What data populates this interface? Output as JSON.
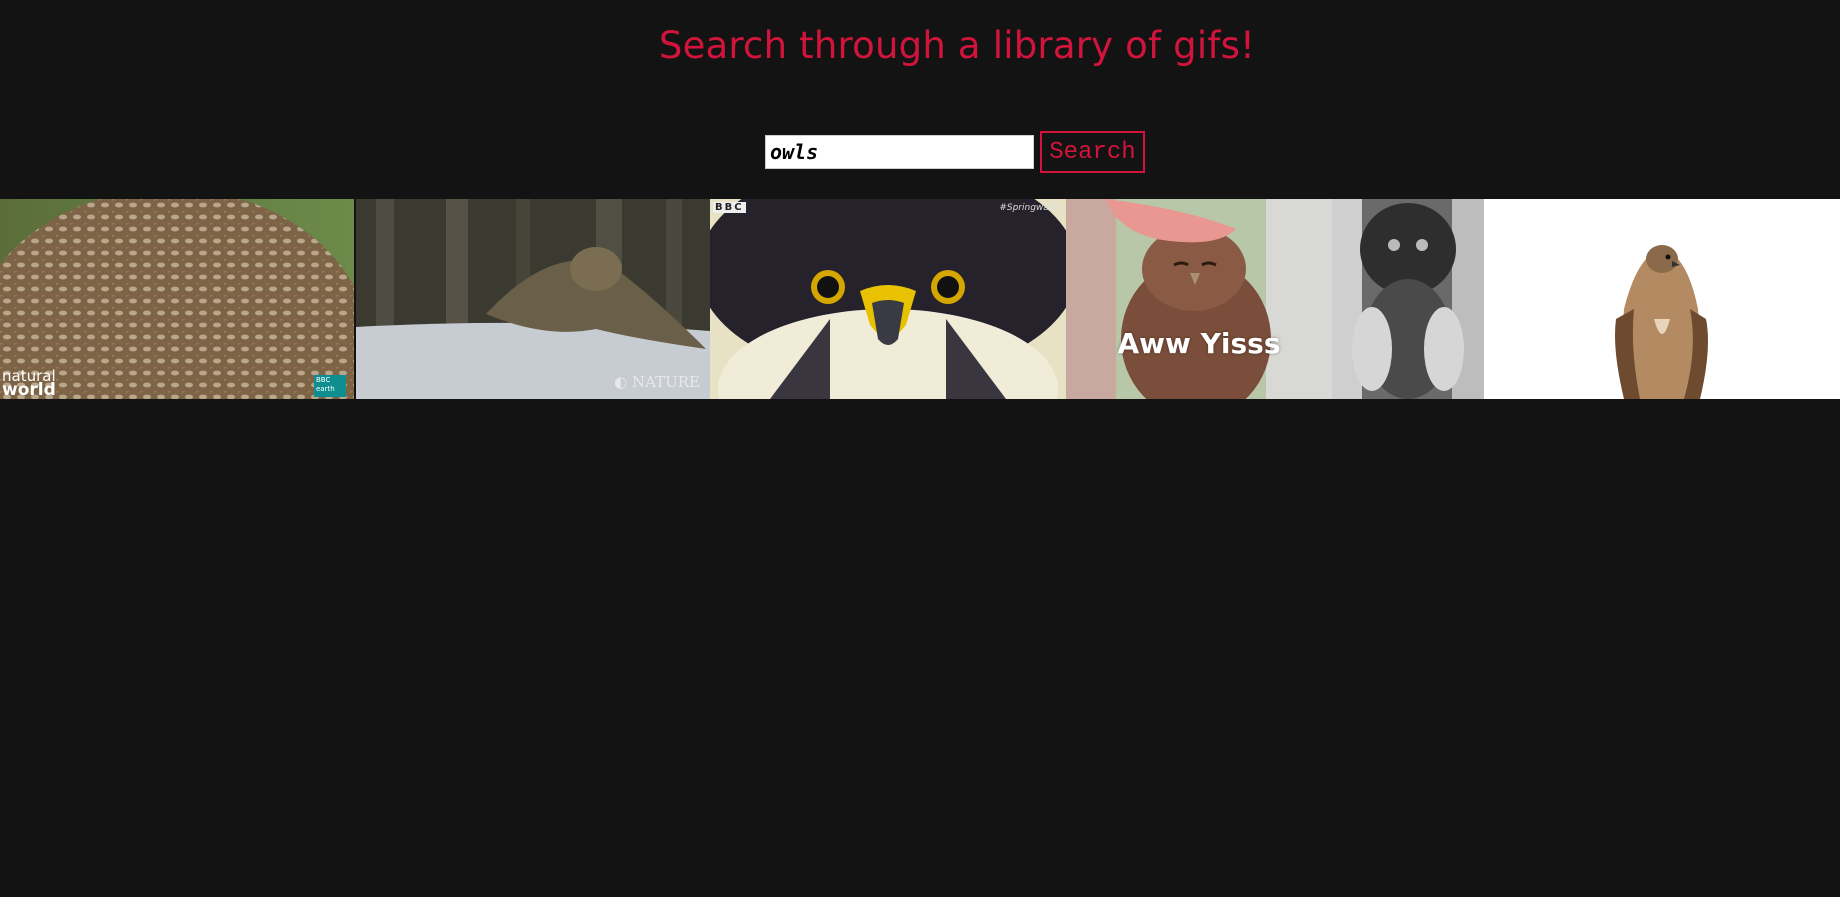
{
  "header": {
    "title": "Search through a library of gifs!"
  },
  "search": {
    "value": "owls",
    "button_label": "Search"
  },
  "results": [
    {
      "name": "owl-closeup-gif",
      "labels": [
        "natural",
        "world",
        "BBC earth"
      ]
    },
    {
      "name": "owl-snow-dive-gif",
      "labels": [
        "NATURE"
      ]
    },
    {
      "name": "falcon-face-gif",
      "labels": [
        "BBC",
        "#Springwatch"
      ]
    },
    {
      "name": "owl-petting-gif",
      "labels": [
        "Aww Yisss"
      ]
    },
    {
      "name": "owl-bw-gif",
      "labels": []
    },
    {
      "name": "hawk-white-bg-gif",
      "labels": []
    }
  ],
  "colors": {
    "background": "#131313",
    "accent": "#d2143c"
  }
}
